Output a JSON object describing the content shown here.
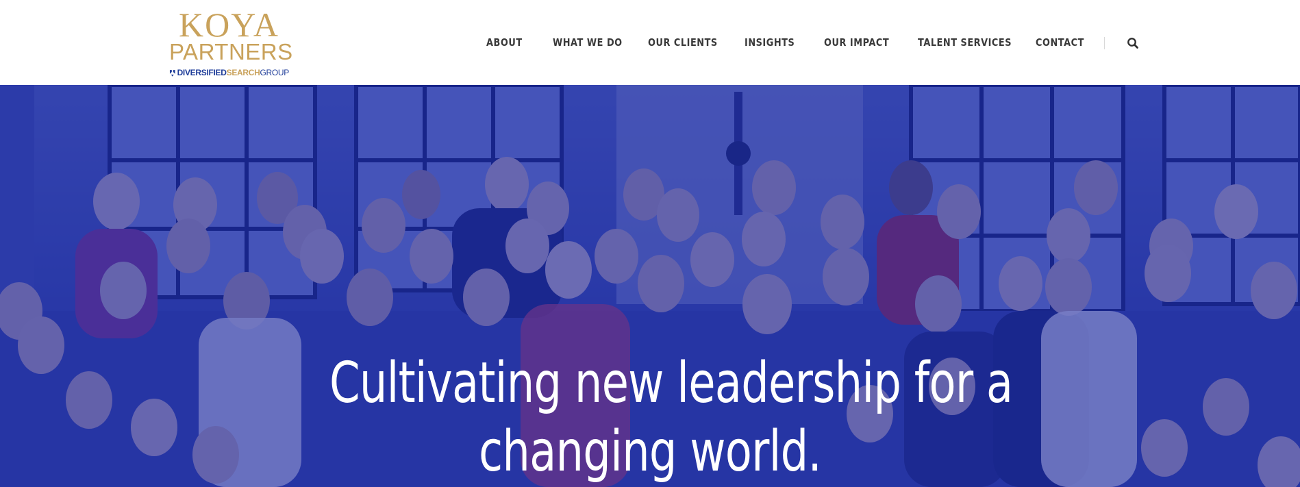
{
  "brand": {
    "logo_line1": "KOYA",
    "logo_line2": "PARTNERS",
    "logo_sub_part1": "DIVERSIFIED",
    "logo_sub_part2": "SEARCH",
    "logo_sub_part3": "GROUP",
    "gold": "#c9a25b",
    "navy": "#1f3d99"
  },
  "nav": {
    "items": [
      {
        "label": "ABOUT"
      },
      {
        "label": "WHAT WE DO"
      },
      {
        "label": "OUR CLIENTS"
      },
      {
        "label": "INSIGHTS"
      },
      {
        "label": "OUR IMPACT"
      },
      {
        "label": "TALENT SERVICES"
      },
      {
        "label": "CONTACT"
      }
    ],
    "search_icon": "search-icon"
  },
  "hero": {
    "heading_line1": "Cultivating new leadership for a",
    "heading_line2": "changing world.",
    "overlay_color": "#1624a0"
  }
}
